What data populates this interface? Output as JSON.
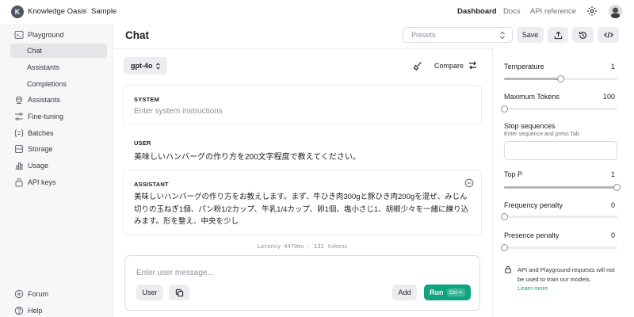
{
  "topbar": {
    "org_initial": "K",
    "org_name": "Knowledge Oasis",
    "separator": "/",
    "project": "Sample",
    "nav": {
      "dashboard": "Dashboard",
      "docs": "Docs",
      "api_reference": "API reference"
    },
    "icons": [
      "gear-icon",
      "user-avatar"
    ]
  },
  "sidebar": {
    "items": [
      {
        "label": "Playground",
        "icon": "terminal-icon"
      },
      {
        "label": "Chat",
        "active": true
      },
      {
        "label": "Assistants"
      },
      {
        "label": "Completions"
      },
      {
        "label": "Assistants",
        "icon": "assistants-icon"
      },
      {
        "label": "Fine-tuning",
        "icon": "fine-tuning-icon"
      },
      {
        "label": "Batches",
        "icon": "batches-icon"
      },
      {
        "label": "Storage",
        "icon": "storage-icon"
      },
      {
        "label": "Usage",
        "icon": "usage-icon"
      },
      {
        "label": "API keys",
        "icon": "lock-icon"
      },
      {
        "label": "Forum",
        "icon": "forum-icon"
      },
      {
        "label": "Help",
        "icon": "help-icon"
      }
    ]
  },
  "main": {
    "title": "Chat",
    "presets_placeholder": "Presets",
    "save_label": "Save",
    "model": "gpt-4o",
    "compare_label": "Compare",
    "system": {
      "role": "SYSTEM",
      "placeholder": "Enter system instructions"
    },
    "user_message": {
      "role": "USER",
      "text": "美味しいハンバーグの作り方を200文字程度で教えてください。"
    },
    "assistant_message": {
      "role": "ASSISTANT",
      "text": "美味しいハンバーグの作り方をお教えします。まず、牛ひき肉300gと豚ひき肉200gを混ぜ、みじん切りの玉ねぎ1個、パン粉1/2カップ、牛乳1/4カップ、卵1個、塩小さじ1、胡椒少々を一緒に練り込みます。形を整え、中央を少し"
    },
    "latency_text": "Latency 4470ms · 131 tokens",
    "composer": {
      "placeholder": "Enter user message...",
      "user_button": "User",
      "add_button": "Add",
      "run_button": "Run",
      "run_shortcut": "Ctrl ↵"
    }
  },
  "params": {
    "temperature": {
      "label": "Temperature",
      "value": "1",
      "fraction": 0.5
    },
    "max_tokens": {
      "label": "Maximum Tokens",
      "value": "100",
      "fraction": 0.0
    },
    "stop_sequences": {
      "label": "Stop sequences",
      "hint": "Enter sequence and press Tab"
    },
    "top_p": {
      "label": "Top P",
      "value": "1",
      "fraction": 1.0
    },
    "frequency_penalty": {
      "label": "Frequency penalty",
      "value": "0",
      "fraction": 0.0
    },
    "presence_penalty": {
      "label": "Presence penalty",
      "value": "0",
      "fraction": 0.0
    },
    "notice": "API and Playground requests will not be used to train our models.",
    "learn_more": "Learn more"
  },
  "colors": {
    "accent": "#10a37f",
    "sidebar_bg": "#f7f7f8",
    "border": "#ececf1"
  }
}
